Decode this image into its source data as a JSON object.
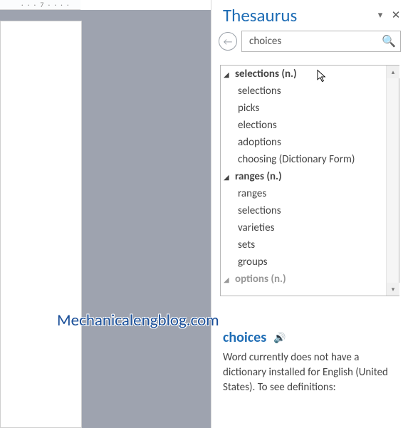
{
  "ruler": {
    "text": "· · · 7 · · · ·"
  },
  "pane": {
    "title": "Thesaurus",
    "dropdown_glyph": "▾",
    "close_glyph": "✕"
  },
  "search": {
    "value": "choices",
    "back_glyph": "←",
    "mag_glyph": "🔍"
  },
  "groups": [
    {
      "header": "selections (n.)",
      "arrow": "◢",
      "synonyms": [
        "selections",
        "picks",
        "elections",
        "adoptions",
        "choosing (Dictionary Form)"
      ]
    },
    {
      "header": "ranges (n.)",
      "arrow": "◢",
      "synonyms": [
        "ranges",
        "selections",
        "varieties",
        "sets",
        "groups"
      ]
    }
  ],
  "truncated_next": "options (n.)",
  "scroll": {
    "up": "▴",
    "down": "▾"
  },
  "definition": {
    "word": "choices",
    "speaker_glyph": "🔊",
    "text": "Word currently does not have a dictionary installed for English (United States). To see definitions:"
  },
  "watermark": "Mechanicalengblog.com"
}
